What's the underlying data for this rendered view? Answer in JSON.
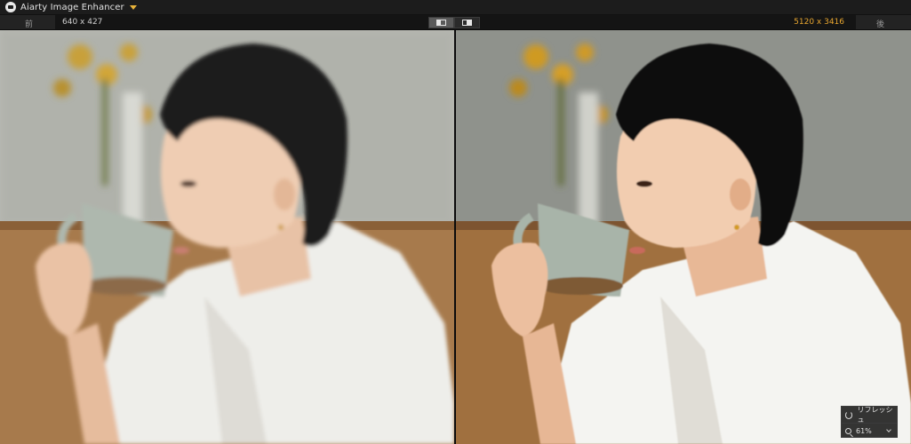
{
  "app": {
    "title": "Aiarty Image Enhancer"
  },
  "compare": {
    "before_label": "前",
    "after_label": "後",
    "before_resolution": "640 x 427",
    "after_resolution": "5120 x 3416",
    "view_modes": [
      "single-view",
      "split-view"
    ],
    "active_mode": "single-view"
  },
  "zoom": {
    "refresh_label": "リフレッシュ",
    "level": "61%"
  },
  "colors": {
    "accent": "#e8a630",
    "background": "#1a1a1a"
  }
}
